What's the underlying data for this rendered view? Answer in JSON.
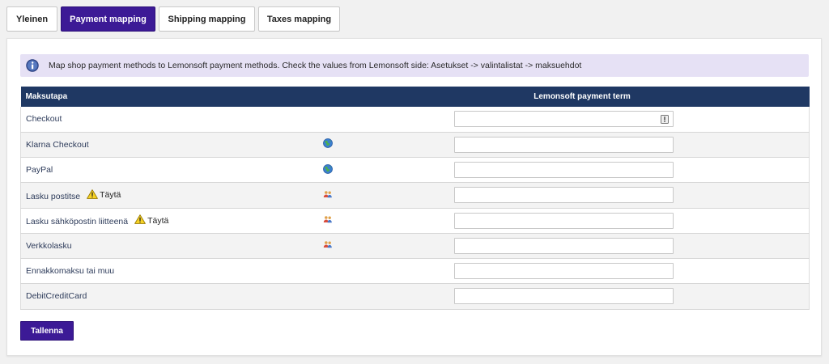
{
  "tabs": [
    {
      "label": "Yleinen",
      "active": false
    },
    {
      "label": "Payment mapping",
      "active": true
    },
    {
      "label": "Shipping mapping",
      "active": false
    },
    {
      "label": "Taxes mapping",
      "active": false
    }
  ],
  "notice": {
    "icon": "info-icon",
    "text": "Map shop payment methods to Lemonsoft payment methods. Check the values from Lemonsoft side: Asetukset -> valintalistat -> maksuehdot"
  },
  "table": {
    "headers": {
      "method": "Maksutapa",
      "term": "Lemonsoft payment term"
    },
    "rows": [
      {
        "name": "Checkout",
        "warning": "",
        "icon": "",
        "value": "",
        "has_validation_icon": true
      },
      {
        "name": "Klarna Checkout",
        "warning": "",
        "icon": "globe-icon",
        "value": ""
      },
      {
        "name": "PayPal",
        "warning": "",
        "icon": "globe-icon",
        "value": ""
      },
      {
        "name": "Lasku postitse",
        "warning": "Täytä",
        "icon": "users-icon",
        "value": ""
      },
      {
        "name": "Lasku sähköpostin liitteenä",
        "warning": "Täytä",
        "icon": "users-icon",
        "value": ""
      },
      {
        "name": "Verkkolasku",
        "warning": "",
        "icon": "users-icon",
        "value": ""
      },
      {
        "name": "Ennakkomaksu tai muu",
        "warning": "",
        "icon": "",
        "value": ""
      },
      {
        "name": "DebitCreditCard",
        "warning": "",
        "icon": "",
        "value": ""
      }
    ]
  },
  "save_label": "Tallenna",
  "colors": {
    "accent": "#3c1a96",
    "header": "#1f3863",
    "notice_bg": "#e6e1f5"
  }
}
